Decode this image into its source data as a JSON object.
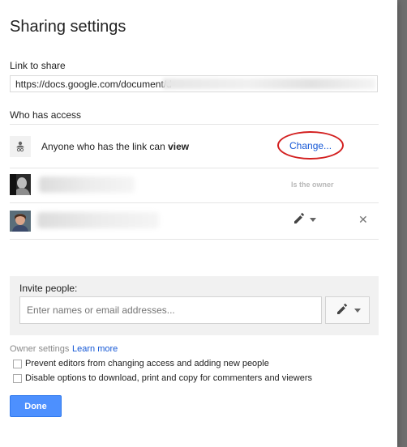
{
  "dialog": {
    "title": "Sharing settings",
    "link_label": "Link to share",
    "link_value": "https://docs.google.com/document/d",
    "who_has_access_label": "Who has access"
  },
  "access": {
    "anyone_prefix": "Anyone who has the link can ",
    "anyone_permission": "view",
    "change_link": "Change...",
    "owner_label": "Is the owner",
    "remove_symbol": "✕"
  },
  "invite": {
    "label": "Invite people:",
    "placeholder": "Enter names or email addresses..."
  },
  "owner_settings": {
    "label": "Owner settings",
    "learn_more": "Learn more",
    "option_prevent": "Prevent editors from changing access and adding new people",
    "option_disable": "Disable options to download, print and copy for commenters and viewers"
  },
  "actions": {
    "done": "Done"
  },
  "icons": {
    "anyone": "link-people-icon",
    "edit": "pencil-icon",
    "dropdown": "caret-down-icon",
    "remove": "close-icon"
  },
  "colors": {
    "link": "#1558d6",
    "primary_button": "#4d90fe",
    "highlight_ellipse": "#d32020"
  }
}
